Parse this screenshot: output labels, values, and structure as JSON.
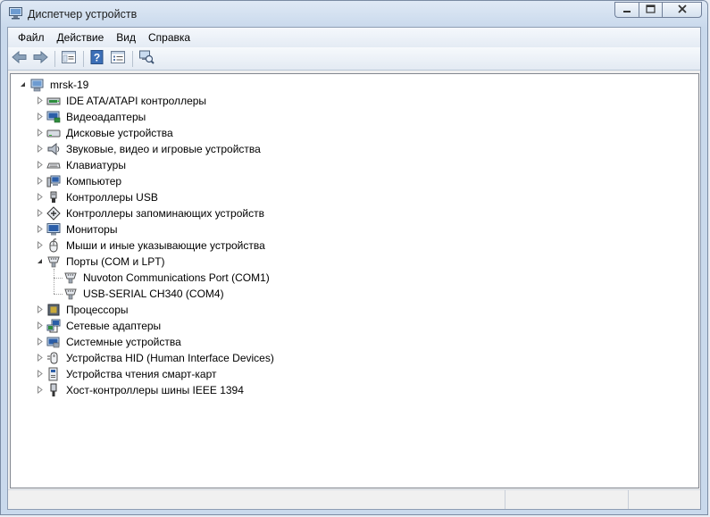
{
  "window": {
    "title": "Диспетчер устройств",
    "buttons": {
      "minimize": "minimize-icon",
      "maximize": "maximize-icon",
      "close": "close-icon"
    }
  },
  "menu": [
    "Файл",
    "Действие",
    "Вид",
    "Справка"
  ],
  "toolbar": [
    "back-icon",
    "forward-icon",
    "console-tree-icon",
    "help-icon",
    "properties-icon",
    "scan-hardware-icon"
  ],
  "tree": {
    "root": "mrsk-19",
    "categories": [
      {
        "label": "IDE ATA/ATAPI контроллеры",
        "icon": "ide-controller-icon",
        "expanded": false
      },
      {
        "label": "Видеоадаптеры",
        "icon": "display-adapter-icon",
        "expanded": false
      },
      {
        "label": "Дисковые устройства",
        "icon": "disk-drive-icon",
        "expanded": false
      },
      {
        "label": "Звуковые, видео и игровые устройства",
        "icon": "speaker-icon",
        "expanded": false
      },
      {
        "label": "Клавиатуры",
        "icon": "keyboard-icon",
        "expanded": false
      },
      {
        "label": "Компьютер",
        "icon": "computer-icon",
        "expanded": false
      },
      {
        "label": "Контроллеры USB",
        "icon": "usb-icon",
        "expanded": false
      },
      {
        "label": "Контроллеры запоминающих устройств",
        "icon": "storage-controller-icon",
        "expanded": false
      },
      {
        "label": "Мониторы",
        "icon": "monitor-icon",
        "expanded": false
      },
      {
        "label": "Мыши и иные указывающие устройства",
        "icon": "mouse-icon",
        "expanded": false
      },
      {
        "label": "Порты (COM и LPT)",
        "icon": "port-icon",
        "expanded": true,
        "children": [
          {
            "label": "Nuvoton Communications Port (COM1)",
            "icon": "port-icon"
          },
          {
            "label": "USB-SERIAL CH340 (COM4)",
            "icon": "port-icon"
          }
        ]
      },
      {
        "label": "Процессоры",
        "icon": "processor-icon",
        "expanded": false
      },
      {
        "label": "Сетевые адаптеры",
        "icon": "network-adapter-icon",
        "expanded": false
      },
      {
        "label": "Системные устройства",
        "icon": "system-device-icon",
        "expanded": false
      },
      {
        "label": "Устройства HID (Human Interface Devices)",
        "icon": "hid-icon",
        "expanded": false
      },
      {
        "label": "Устройства чтения смарт-карт",
        "icon": "smart-card-reader-icon",
        "expanded": false
      },
      {
        "label": "Хост-контроллеры шины IEEE 1394",
        "icon": "ieee1394-icon",
        "expanded": false
      }
    ]
  }
}
